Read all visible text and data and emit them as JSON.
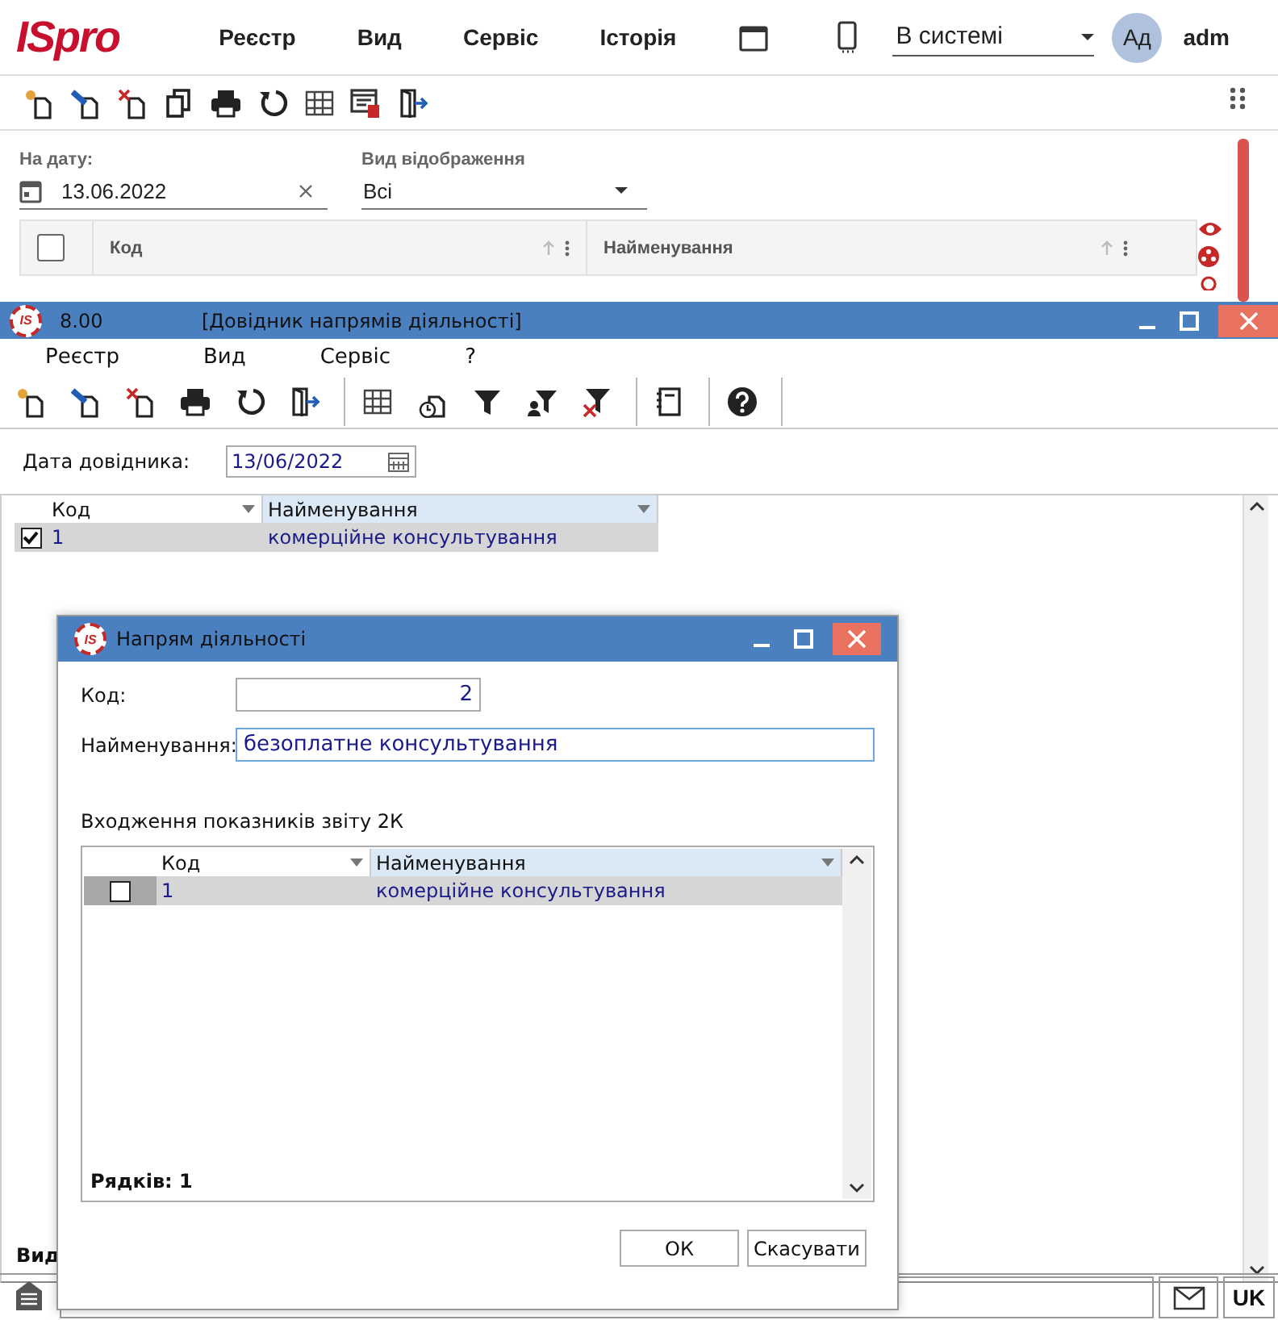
{
  "app": {
    "logo": "ISpro",
    "menu": [
      "Реєстр",
      "Вид",
      "Сервіс",
      "Історія"
    ],
    "status_select": "В системі",
    "avatar": "Ад",
    "user": "adm",
    "filters": {
      "date_label": "На дату:",
      "date": "13.06.2022",
      "view_label": "Вид відображення",
      "view": "Всі"
    },
    "grid": {
      "all_checked": false,
      "columns": [
        "Код",
        "Найменування"
      ]
    }
  },
  "window": {
    "logo": "IS",
    "number": "8.00",
    "title": "[Довідник напрямів діяльності]",
    "menu": [
      "Реєстр",
      "Вид",
      "Сервіс",
      "?"
    ],
    "date_label": "Дата довідника:",
    "date": "13/06/2022",
    "columns": [
      "Код",
      "Найменування"
    ],
    "rows": [
      {
        "code": "1",
        "name": "комерційне консультування",
        "checked": true
      }
    ],
    "footer": "Вид"
  },
  "dialog": {
    "logo": "IS",
    "title": "Напрям діяльності",
    "code_label": "Код:",
    "code": "2",
    "name_label": "Найменування:",
    "name": "безоплатне консультування",
    "group_label": "Входження показників звіту 2К",
    "columns": [
      "Код",
      "Найменування"
    ],
    "rows": [
      {
        "code": "1",
        "name": "комерційне консультування",
        "checked": false
      }
    ],
    "row_count": "Рядків: 1",
    "buttons": [
      "ОК",
      "Скасувати"
    ]
  },
  "status_bar": {
    "language": "UK"
  }
}
